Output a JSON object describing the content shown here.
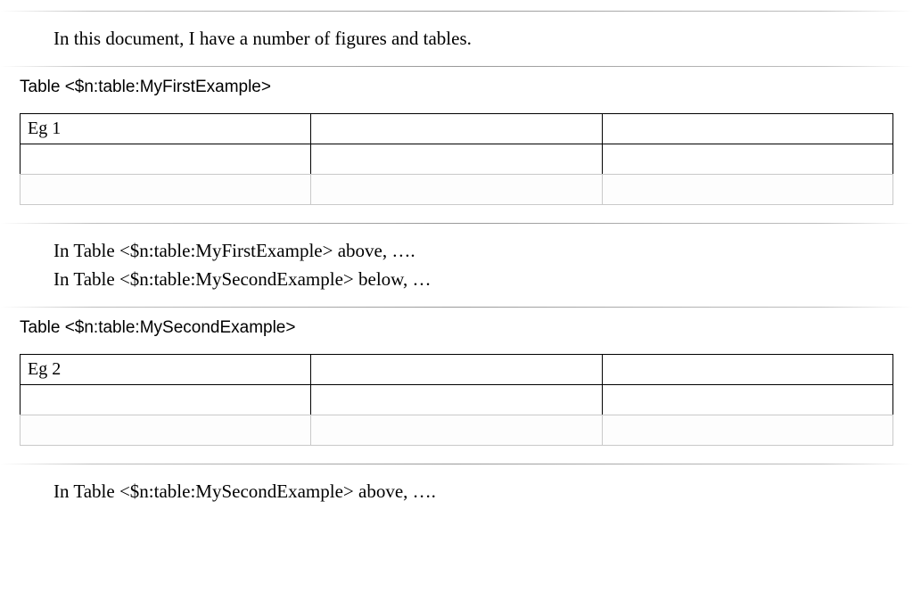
{
  "intro_text": "In this document, I have a number of figures and tables.",
  "table1": {
    "caption": "Table <$n:table:MyFirstExample>",
    "rows": [
      [
        "Eg 1",
        "",
        ""
      ],
      [
        "",
        "",
        ""
      ],
      [
        "",
        "",
        ""
      ]
    ]
  },
  "mid_text": {
    "line1": "In Table <$n:table:MyFirstExample> above, ….",
    "line2": "In Table <$n:table:MySecondExample> below, …"
  },
  "table2": {
    "caption": "Table <$n:table:MySecondExample>",
    "rows": [
      [
        "Eg 2",
        "",
        ""
      ],
      [
        "",
        "",
        ""
      ],
      [
        "",
        "",
        ""
      ]
    ]
  },
  "outro_text": "In Table <$n:table:MySecondExample> above, …."
}
